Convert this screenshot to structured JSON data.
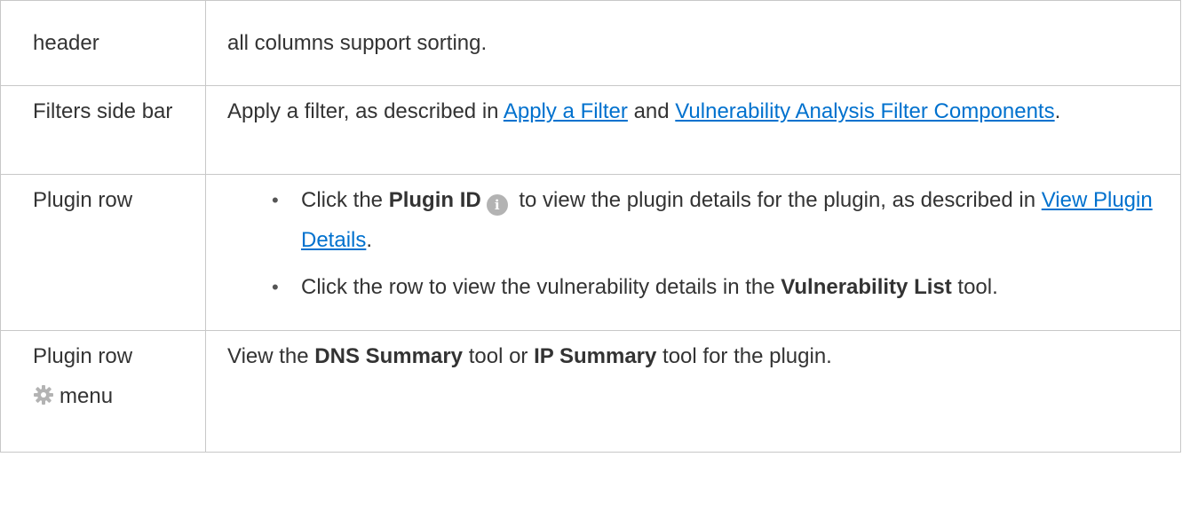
{
  "rows": [
    {
      "label": "header",
      "description": "all columns support sorting."
    },
    {
      "label": "Filters side bar",
      "description_prefix": "Apply a filter, as described in ",
      "link1": "Apply a Filter",
      "middle": " and ",
      "link2": "Vulnerability Analysis Filter Components",
      "suffix": "."
    },
    {
      "label": "Plugin row",
      "bullets": [
        {
          "prefix": "Click the ",
          "bold": "Plugin ID",
          "icon": "info-icon",
          "middle": " to view the plugin details for the plugin, as described in ",
          "link": "View Plugin Details",
          "suffix": "."
        },
        {
          "prefix": "Click the row to view the vulnerability details in the ",
          "bold": "Vulnerability List",
          "suffix": " tool."
        }
      ]
    },
    {
      "label_line1": "Plugin row",
      "label_icon": "gear-icon",
      "label_line2": "menu",
      "prefix": "View the ",
      "bold1": "DNS Summary",
      "middle": " tool or ",
      "bold2": "IP Summary",
      "suffix": " tool for the plugin."
    }
  ],
  "colors": {
    "link": "#0071ce",
    "text": "#333333",
    "border": "#c8c8c8",
    "icon": "#b3b3b3"
  }
}
